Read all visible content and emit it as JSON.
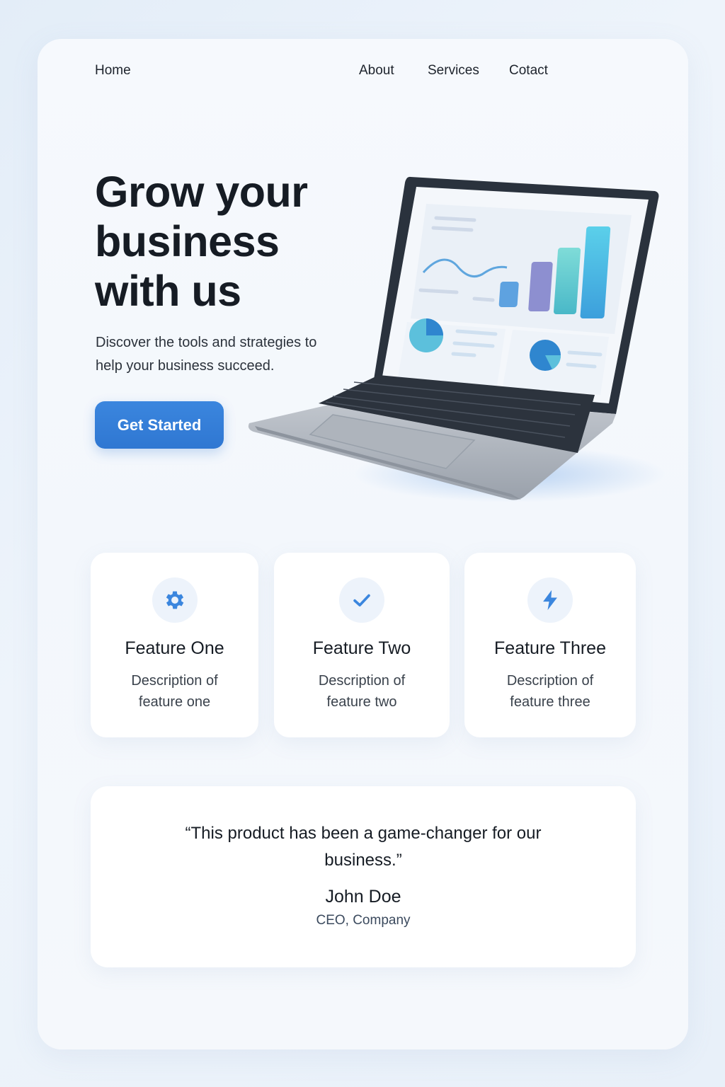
{
  "nav": {
    "home": "Home",
    "about": "About",
    "services": "Services",
    "contact": "Cotact"
  },
  "hero": {
    "title": "Grow your business with us",
    "subtitle": "Discover the tools and strategies to help your business succeed.",
    "cta_label": "Get Started"
  },
  "features": [
    {
      "icon": "gear-icon",
      "title": "Feature One",
      "description": "Description of feature one"
    },
    {
      "icon": "checkmark-icon",
      "title": "Feature Two",
      "description": "Description of feature two"
    },
    {
      "icon": "lightning-icon",
      "title": "Feature Three",
      "description": "Description of feature three"
    }
  ],
  "testimonial": {
    "quote": "“This product has been a game-changer for our business.”",
    "author": "John Doe",
    "role": "CEO, Company"
  },
  "colors": {
    "accent": "#2f77d2",
    "icon_blue": "#3b86de",
    "text_dark": "#161c24"
  }
}
